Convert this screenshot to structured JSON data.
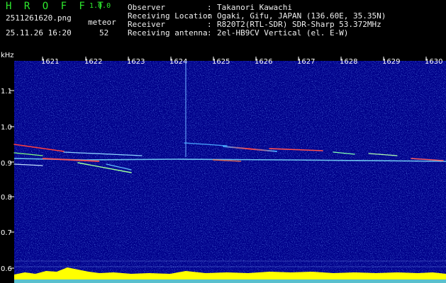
{
  "app": {
    "title": "H R O F F T",
    "version": "1.0.0"
  },
  "file_name": "2511261620.png",
  "datetime": "25.11.26 16:20",
  "meteor": {
    "label": "meteor",
    "count": "52"
  },
  "info": [
    {
      "key": "Observer",
      "value": "Takanori Kawachi"
    },
    {
      "key": "Receiving Location",
      "value": "Ogaki, Gifu, JAPAN (136.60E, 35.35N)"
    },
    {
      "key": "Receiver",
      "value": "R820T2(RTL-SDR) SDR-Sharp 53.372MHz"
    },
    {
      "key": "Receiving antenna",
      "value": "2el-HB9CV Vertical (el. E-W)"
    }
  ],
  "spectrogram": {
    "y_unit": "kHz",
    "y_ticks": [
      "1.1",
      "1.0",
      "0.9",
      "0.8",
      "0.7",
      "0.6"
    ],
    "x_ticks": [
      "1621",
      "1622",
      "1623",
      "1624",
      "1625",
      "1626",
      "1627",
      "1628",
      "1629",
      "1630"
    ],
    "colors": {
      "background": "#00008a",
      "signal": "#ff3030",
      "baseline": "#ffff00"
    }
  }
}
